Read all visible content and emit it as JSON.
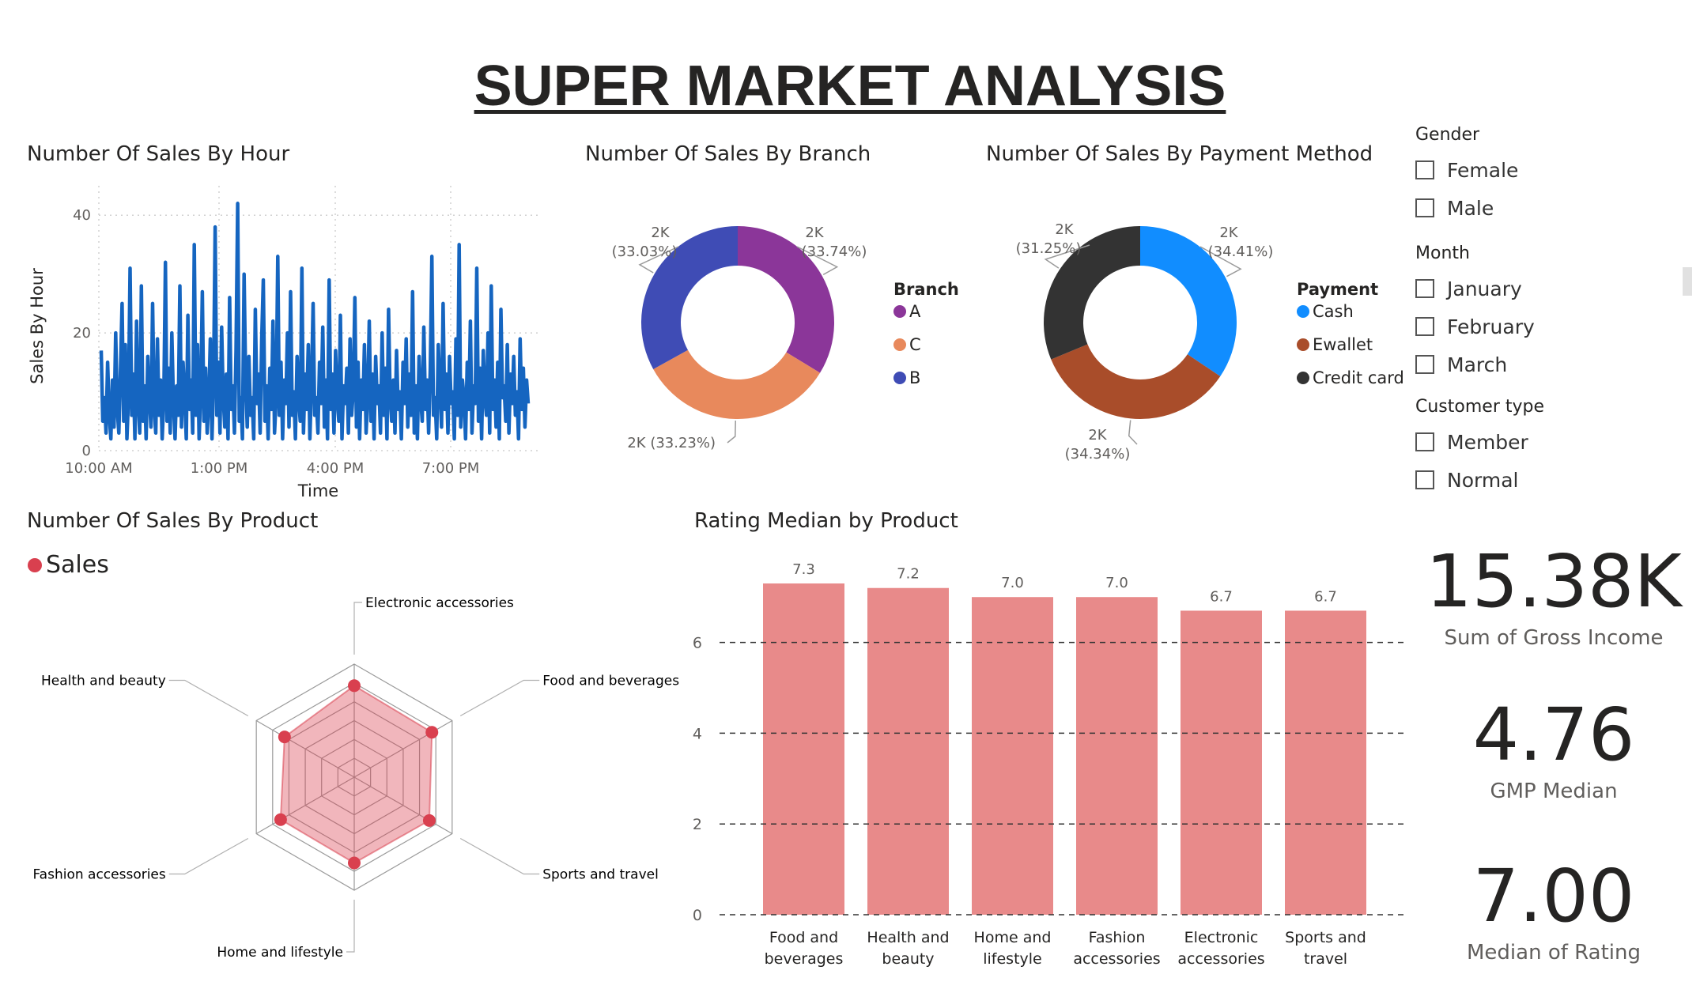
{
  "title": "SUPER MARKET ANALYSIS",
  "visuals": {
    "hour": {
      "title": "Number Of Sales By Hour"
    },
    "branch": {
      "title": "Number Of Sales By Branch",
      "legend_title": "Branch"
    },
    "payment": {
      "title": "Number Of Sales By Payment Method",
      "legend_title": "Payment"
    },
    "product": {
      "title": "Number Of Sales By Product",
      "legend_label": "Sales"
    },
    "rating": {
      "title": "Rating Median by Product"
    }
  },
  "slicers": [
    {
      "header": "Gender",
      "items": [
        "Female",
        "Male"
      ]
    },
    {
      "header": "Month",
      "items": [
        "January",
        "February",
        "March"
      ]
    },
    {
      "header": "Customer type",
      "items": [
        "Member",
        "Normal"
      ]
    }
  ],
  "kpis": [
    {
      "value": "15.38K",
      "label": "Sum of Gross Income"
    },
    {
      "value": "4.76",
      "label": "GMP Median"
    },
    {
      "value": "7.00",
      "label": "Median of Rating"
    }
  ],
  "colors": {
    "line": "#1565c0",
    "branch_A": "#8b3699",
    "branch_C": "#e8895c",
    "branch_B": "#3f4cb5",
    "pay_Cash": "#118dff",
    "pay_Ewallet": "#a94d2a",
    "pay_Credit": "#333333",
    "radar": "#d9404f",
    "bar": "#e88a8a"
  },
  "chart_data": [
    {
      "type": "line",
      "title": "Number Of Sales By Hour",
      "xlabel": "Time",
      "ylabel": "Sales By Hour",
      "x_ticks": [
        "10:00 AM",
        "1:00 PM",
        "4:00 PM",
        "7:00 PM"
      ],
      "x_range": [
        "10:00 AM",
        "9:00 PM"
      ],
      "ylim": [
        0,
        45
      ],
      "y_ticks": [
        0,
        20,
        40
      ],
      "grid": true,
      "series": [
        {
          "values": [
            17,
            5,
            9,
            3,
            15,
            6,
            2,
            12,
            4,
            20,
            7,
            3,
            14,
            25,
            5,
            18,
            2,
            9,
            31,
            6,
            13,
            2,
            22,
            8,
            3,
            28,
            5,
            11,
            2,
            16,
            9,
            4,
            25,
            7,
            3,
            19,
            6,
            12,
            2,
            9,
            32,
            5,
            14,
            3,
            20,
            8,
            2,
            11,
            6,
            28,
            4,
            15,
            9,
            2,
            23,
            7,
            12,
            3,
            35,
            6,
            18,
            2,
            10,
            27,
            5,
            14,
            3,
            8,
            19,
            2,
            12,
            38,
            6,
            15,
            3,
            21,
            9,
            4,
            13,
            2,
            26,
            7,
            11,
            3,
            17,
            42,
            5,
            9,
            2,
            30,
            12,
            4,
            16,
            6,
            9,
            2,
            24,
            8,
            13,
            3,
            19,
            29,
            5,
            11,
            2,
            14,
            7,
            22,
            3,
            9,
            33,
            6,
            15,
            2,
            12,
            8,
            20,
            4,
            27,
            6,
            10,
            2,
            16,
            9,
            5,
            31,
            3,
            13,
            7,
            18,
            2,
            11,
            25,
            6,
            9,
            3,
            15,
            8,
            21,
            4,
            12,
            2,
            29,
            7,
            13,
            3,
            17,
            9,
            5,
            23,
            2,
            11,
            8,
            14,
            3,
            19,
            6,
            10,
            26,
            4,
            15,
            2,
            12,
            7,
            18,
            3,
            9,
            22,
            5,
            13,
            2,
            16,
            8,
            11,
            3,
            20,
            6,
            14,
            2,
            24,
            9,
            5,
            12,
            3,
            17,
            7,
            10,
            2,
            15,
            8,
            19,
            4,
            13,
            6,
            27,
            3,
            11,
            2,
            16,
            9,
            5,
            21,
            7,
            12,
            3,
            14,
            33,
            6,
            9,
            2,
            18,
            11,
            4,
            25,
            7,
            13,
            3,
            16,
            8,
            10,
            2,
            19,
            6,
            35,
            4,
            12,
            9,
            2,
            15,
            7,
            22,
            3,
            11,
            8,
            31,
            5,
            14,
            2,
            17,
            9,
            6,
            20,
            3,
            28,
            7,
            12,
            4,
            15,
            2,
            24,
            9,
            11,
            5,
            18,
            3,
            13,
            8,
            16,
            6,
            10,
            2,
            19,
            7,
            14,
            4,
            12,
            8
          ]
        }
      ]
    },
    {
      "type": "pie",
      "title": "Number Of Sales By Branch",
      "legend": [
        "A",
        "C",
        "B"
      ],
      "slices": [
        {
          "name": "A",
          "value": 2000,
          "label": "2K",
          "pct": "(33.74%)",
          "percent": 33.74
        },
        {
          "name": "C",
          "value": 2000,
          "label": "2K",
          "pct": "(33.23%)",
          "percent": 33.23
        },
        {
          "name": "B",
          "value": 2000,
          "label": "2K",
          "pct": "(33.03%)",
          "percent": 33.03
        }
      ]
    },
    {
      "type": "pie",
      "title": "Number Of Sales By Payment Method",
      "legend": [
        "Cash",
        "Ewallet",
        "Credit card"
      ],
      "slices": [
        {
          "name": "Cash",
          "value": 2000,
          "label": "2K",
          "pct": "(34.41%)",
          "percent": 34.41
        },
        {
          "name": "Ewallet",
          "value": 2000,
          "label": "2K",
          "pct": "(34.34%)",
          "percent": 34.34
        },
        {
          "name": "Credit card",
          "value": 2000,
          "label": "2K",
          "pct": "(31.25%)",
          "percent": 31.25
        }
      ]
    },
    {
      "type": "radar",
      "title": "Number Of Sales By Product",
      "series_name": "Sales",
      "categories": [
        "Electronic accessories",
        "Food and beverages",
        "Sports and travel",
        "Home and lifestyle",
        "Fashion accessories",
        "Health and beauty"
      ],
      "values": [
        971,
        952,
        920,
        911,
        902,
        854
      ],
      "rmax": 1200,
      "rings": 6
    },
    {
      "type": "bar",
      "title": "Rating Median by Product",
      "categories": [
        [
          "Food and",
          "beverages"
        ],
        [
          "Health and",
          "beauty"
        ],
        [
          "Home and",
          "lifestyle"
        ],
        [
          "Fashion",
          "accessories"
        ],
        [
          "Electronic",
          "accessories"
        ],
        [
          "Sports and",
          "travel"
        ]
      ],
      "values": [
        7.3,
        7.2,
        7.0,
        7.0,
        6.7,
        6.7
      ],
      "labels": [
        "7.3",
        "7.2",
        "7.0",
        "7.0",
        "6.7",
        "6.7"
      ],
      "ylim": [
        0,
        7.3
      ],
      "y_ticks": [
        0,
        2,
        4,
        6
      ]
    }
  ]
}
